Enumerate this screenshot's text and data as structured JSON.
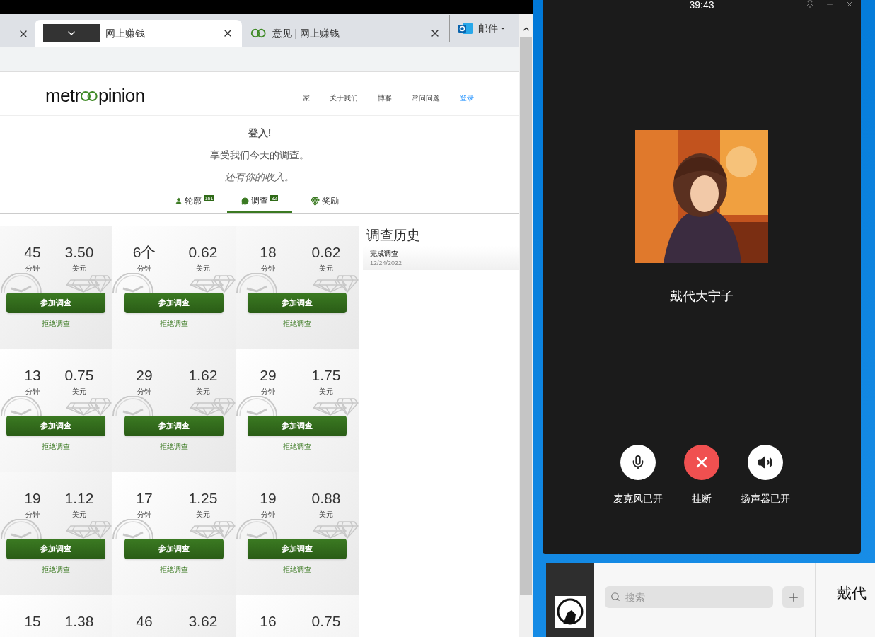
{
  "browser": {
    "tabs": [
      {
        "selected": false,
        "kind": "partial"
      },
      {
        "title": "网上赚钱",
        "selected": true,
        "kind": "covered"
      },
      {
        "title": "意见 | 网上赚钱",
        "selected": false,
        "kind": "rings"
      },
      {
        "title": "邮件 -",
        "selected": false,
        "kind": "mail"
      }
    ]
  },
  "site": {
    "logo": {
      "before": "metr",
      "after": "pinion"
    },
    "nav": [
      {
        "label": "家",
        "highlighted": false
      },
      {
        "label": "关于我们",
        "highlighted": false
      },
      {
        "label": "博客",
        "highlighted": false
      },
      {
        "label": "常问问题",
        "highlighted": false
      },
      {
        "label": "登录",
        "highlighted": true
      }
    ],
    "hero": {
      "title": "登入!",
      "line": "享受我们今天的调查。",
      "tagline": "还有你的收入。"
    },
    "tabs": [
      {
        "label": "轮廓",
        "badge": "161",
        "kind": "profile",
        "selected": false
      },
      {
        "label": "调查",
        "badge": "32",
        "kind": "surveys",
        "selected": true
      },
      {
        "label": "奖励",
        "kind": "rewards",
        "selected": false
      }
    ],
    "surveys": [
      {
        "minutes": "45",
        "minutes_unit": "分钟",
        "price": "3.50",
        "price_unit": "美元",
        "action": "参加调查",
        "decline": "拒绝调查"
      },
      {
        "minutes": "6个",
        "minutes_unit": "分钟",
        "price": "0.62",
        "price_unit": "美元",
        "action": "参加调查",
        "decline": "拒绝调查"
      },
      {
        "minutes": "18",
        "minutes_unit": "分钟",
        "price": "0.62",
        "price_unit": "美元",
        "action": "参加调查",
        "decline": "拒绝调查"
      },
      {
        "minutes": "13",
        "minutes_unit": "分钟",
        "price": "0.75",
        "price_unit": "美元",
        "action": "参加调查",
        "decline": "拒绝调查"
      },
      {
        "minutes": "29",
        "minutes_unit": "分钟",
        "price": "1.62",
        "price_unit": "美元",
        "action": "参加调查",
        "decline": "拒绝调查"
      },
      {
        "minutes": "29",
        "minutes_unit": "分钟",
        "price": "1.75",
        "price_unit": "美元",
        "action": "参加调查",
        "decline": "拒绝调查"
      },
      {
        "minutes": "19",
        "minutes_unit": "分钟",
        "price": "1.12",
        "price_unit": "美元",
        "action": "参加调查",
        "decline": "拒绝调查"
      },
      {
        "minutes": "17",
        "minutes_unit": "分钟",
        "price": "1.25",
        "price_unit": "美元",
        "action": "参加调查",
        "decline": "拒绝调查"
      },
      {
        "minutes": "19",
        "minutes_unit": "分钟",
        "price": "0.88",
        "price_unit": "美元",
        "action": "参加调查",
        "decline": "拒绝调查"
      },
      {
        "minutes": "15",
        "price": "1.38"
      },
      {
        "minutes": "46",
        "price": "3.62"
      },
      {
        "minutes": "16",
        "price": "0.75"
      }
    ],
    "history": {
      "title": "调查历史",
      "items": [
        {
          "label": "完成调查",
          "date": "12/24/2022"
        }
      ]
    }
  },
  "call": {
    "timer": "39:43",
    "name": "戴代大宁子",
    "controls": [
      {
        "kind": "mic",
        "label": "麦克风已开"
      },
      {
        "kind": "hangup",
        "label": "挂断"
      },
      {
        "kind": "speaker",
        "label": "扬声器已开"
      }
    ]
  },
  "chat": {
    "search": {
      "placeholder": "搜索"
    },
    "contact": "戴代"
  }
}
